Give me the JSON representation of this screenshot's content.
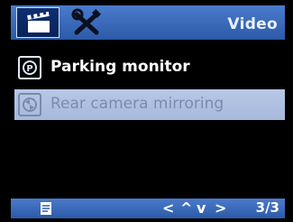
{
  "header": {
    "title": "Video",
    "tabs": [
      {
        "icon": "video-clapper-icon",
        "active": true
      },
      {
        "icon": "tools-icon",
        "active": false
      }
    ]
  },
  "menu": {
    "items": [
      {
        "label": "Parking monitor",
        "icon": "parking-monitor-icon",
        "selected": false
      },
      {
        "label": "Rear camera mirroring",
        "icon": "mirroring-icon",
        "selected": true
      }
    ]
  },
  "footer": {
    "left_icon": "document-icon",
    "nav": {
      "left": "<",
      "up": "^",
      "down": "v",
      "right": ">"
    },
    "page": "3/3"
  },
  "colors": {
    "bar_top": "#4b7bcc",
    "bar_bottom": "#2c5aa8",
    "selected_bg": "#b7c7e6",
    "selected_text": "#7b8bb1"
  }
}
